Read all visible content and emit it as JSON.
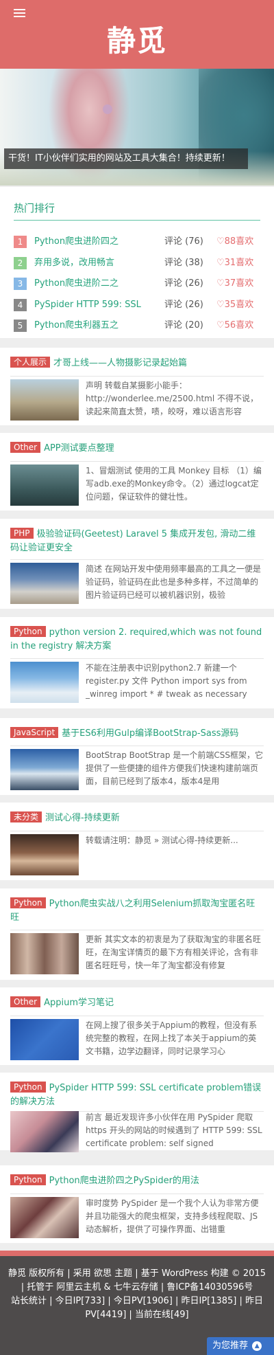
{
  "header": {
    "title": "静觅",
    "menu_icon": "menu-icon"
  },
  "banner": {
    "caption": "干货！IT小伙伴们实用的网站及工具大集合！持续更新！"
  },
  "hot": {
    "title": "热门排行",
    "items": [
      {
        "rank": "1",
        "title": "Python爬虫进阶四之",
        "comments": "评论 (76)",
        "likes": "♡88喜欢",
        "color": "#ef8a89"
      },
      {
        "rank": "2",
        "title": "弃用多说，改用畅言",
        "comments": "评论 (38)",
        "likes": "♡31喜欢",
        "color": "#8ed08e"
      },
      {
        "rank": "3",
        "title": "Python爬虫进阶二之",
        "comments": "评论 (26)",
        "likes": "♡37喜欢",
        "color": "#86b8e6"
      },
      {
        "rank": "4",
        "title": "PySpider HTTP 599: SSL",
        "comments": "评论 (26)",
        "likes": "♡35喜欢",
        "color": "#888888"
      },
      {
        "rank": "5",
        "title": "Python爬虫利器五之",
        "comments": "评论 (20)",
        "likes": "♡56喜欢",
        "color": "#888888"
      }
    ]
  },
  "posts": [
    {
      "badge": "个人展示",
      "title": "才哥上线——人物摄影记录起始篇",
      "excerpt": "声明 转载自某摄影小能手：http://wonderlee.me/2500.html 不得不说，读起来简直太赞，啧，皎呀，难以语言形容"
    },
    {
      "badge": "Other",
      "title": "APP测试要点整理",
      "excerpt": "1、冒烟测试 使用的工具 Monkey 目标 （1）编写adb.exe的Monkey命令。（2）通过logcat定位问题，保证软件的健壮性。"
    },
    {
      "badge": "PHP",
      "title": "极验验证码(Geetest) Laravel 5 集成开发包, 滑动二维码让验证更安全",
      "excerpt": "简述 在网站开发中使用频率最高的工具之一便是验证码，验证码在此也是多种多样，不过简单的图片验证码已经可以被机器识别，极验"
    },
    {
      "badge": "Python",
      "title": "python version 2. required,which was not found in the registry 解决方案",
      "excerpt": "不能在注册表中识别python2.7 新建一个register.py 文件 Python import sys from _winreg import * # tweak as necessary"
    },
    {
      "badge": "JavaScript",
      "title": "基于ES6利用Gulp编译BootStrap-Sass源码",
      "excerpt": "BootStrap BootStrap 是一个前端CSS框架，它提供了一些便捷的组件方便我们快速构建前端页面，目前已经到了版本4，版本4是用"
    },
    {
      "badge": "未分类",
      "title": "测试心得-持续更新",
      "excerpt": "转载请注明：静觅 » 测试心得-持续更新..."
    },
    {
      "badge": "Python",
      "title": "Python爬虫实战八之利用Selenium抓取淘宝匿名旺旺",
      "excerpt": "更新 其实文本的初衷是为了获取淘宝的非匿名旺旺，在淘宝详情页的最下方有相关评论，含有非匿名旺旺号，快一年了淘宝都没有修复"
    },
    {
      "badge": "Other",
      "title": "Appium学习笔记",
      "excerpt": "在网上搜了很多关于Appium的教程，但没有系统完整的教程，在网上找了本关于appium的英文书籍，边学边翻译，同时记录学习心"
    },
    {
      "badge": "Python",
      "title": "PySpider HTTP 599: SSL certificate problem错误的解决方法",
      "excerpt": "前言 最近发现许多小伙伴在用 PySpider 爬取 https 开头的网站的时候遇到了 HTTP 599: SSL certificate problem: self signed"
    },
    {
      "badge": "Python",
      "title": "Python爬虫进阶四之PySpider的用法",
      "excerpt": "审时度势 PySpider 是一个我个人认为非常方便并且功能强大的爬虫框架，支持多线程爬取、JS动态解析，提供了可操作界面、出错重"
    }
  ],
  "footer": {
    "line1": "静觅 版权所有 | 采用 欲思 主题 | 基于 WordPress 构建 © 2015 | 托管于 阿里云主机 & 七牛云存储 | 鲁ICP备14030596号",
    "stats": "站长统计 | 今日IP[733] | 今日PV[1906] | 昨日IP[1385] | 昨日PV[4419] | 当前在线[49]",
    "recommend": "为您推荐",
    "recommend_icon": "chevron-up-icon"
  }
}
